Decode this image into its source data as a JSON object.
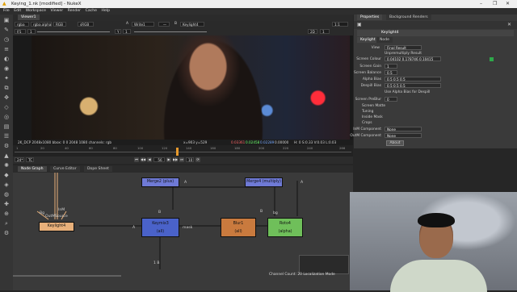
{
  "window": {
    "title": "Keying_1.nk [modified] - NukeX",
    "controls": [
      "–",
      "❐",
      "✕"
    ]
  },
  "menubar": [
    "File",
    "Edit",
    "Workspace",
    "Viewer",
    "Render",
    "Cache",
    "Help"
  ],
  "viewer": {
    "tab": "Viewer1",
    "channels": "rgba",
    "layer": "rgba.alpha",
    "colorspace": "RGB",
    "input_a": "sRGB",
    "a_label": "A",
    "a_node": "Write1",
    "b_label": "B",
    "b_node": "Keylight4",
    "zoom": "1:1",
    "gain": "f/1",
    "gain_value": "1",
    "gamma_label": "Y",
    "gamma_value": "1",
    "ip_label": "2D",
    "frame": "1",
    "info_left": "2K_DCP 2048x1080  bbox: 0 0 2048 1080  channels: rgb",
    "info_xy": "x=903 y=529",
    "info_rgb": [
      "0.03361",
      "0.02458",
      "0.02289",
      "0.00000"
    ],
    "info_hsvl": "H: 0 S:0.33 V:0.03  L:0.03"
  },
  "timeline": {
    "ticks": [
      "1",
      "20",
      "40",
      "60",
      "80",
      "100",
      "120",
      "140",
      "160",
      "180",
      "200",
      "220",
      "240",
      "266"
    ],
    "fps": "24*",
    "tc": "TC",
    "frame_field": "56",
    "increment": "10"
  },
  "nodegraph": {
    "tabs": [
      "Node Graph",
      "Curve Editor",
      "Dope Sheet"
    ],
    "nodes": [
      {
        "label": "Merge2 (plus)",
        "color": "#6f7ad6"
      },
      {
        "label": "Merge4 (multiply)",
        "color": "#6f7ad6"
      },
      {
        "label": "Keymix3\n(all)",
        "color": "#4a62c9"
      },
      {
        "label": "Blur1\n(all)",
        "color": "#c97a3e"
      },
      {
        "label": "Roto4\n(alpha)",
        "color": "#6fbf5a"
      },
      {
        "label": "Keylight4",
        "color": "#e8b07a"
      }
    ],
    "edge_labels": [
      "A",
      "B",
      "A",
      "B",
      "A",
      "mask",
      "bg",
      "Bg",
      "InM",
      "OutM",
      "Source",
      "1 B"
    ],
    "status": "Channel Count: 20  Localization Mode"
  },
  "properties": {
    "tabs": [
      "Properties",
      "Background Renders"
    ],
    "node_name": "Keylight4",
    "node_tabs": [
      "Keylight",
      "Node"
    ],
    "rows": [
      {
        "label": "View",
        "value": "Final Result"
      },
      {
        "label": "",
        "value": "Unpremultiply Result"
      },
      {
        "label": "Screen Colour",
        "value": "0.04102    0.178746    0.10415"
      },
      {
        "label": "Screen Gain",
        "value": "1"
      },
      {
        "label": "Screen Balance",
        "value": "0.5"
      },
      {
        "label": "Alpha Bias",
        "value": "0.5        0.5        0.5"
      },
      {
        "label": "Despill Bias",
        "value": "0.5        0.5        0.5"
      },
      {
        "label": "",
        "value": "Use Alpha Bias for Despill"
      },
      {
        "label": "Screen PreBlur",
        "value": "0"
      },
      {
        "label": "Screen Matte",
        "value": ""
      },
      {
        "label": "Tuning",
        "value": ""
      },
      {
        "label": "Inside Mask",
        "value": ""
      },
      {
        "label": "Crops",
        "value": ""
      },
      {
        "label": "InM Component",
        "value": "None"
      },
      {
        "label": "OutM Component",
        "value": "None"
      }
    ],
    "about": "About"
  }
}
